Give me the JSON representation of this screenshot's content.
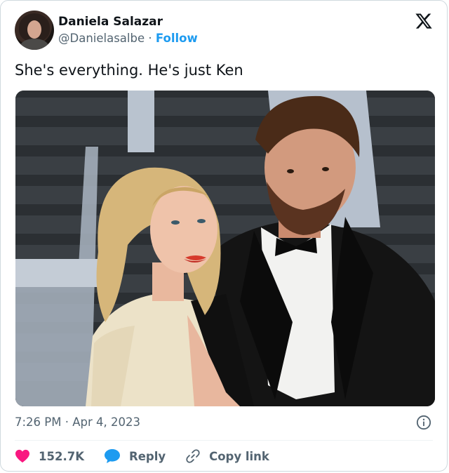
{
  "author": {
    "name": "Daniela Salazar",
    "handle": "@Danielasalbe",
    "separator": "·",
    "follow_label": "Follow"
  },
  "tweet": {
    "text": "She's everything. He's just Ken",
    "time": "7:26 PM",
    "date_separator": "·",
    "date": "Apr 4, 2023"
  },
  "actions": {
    "likes": "152.7K",
    "reply_label": "Reply",
    "copy_link_label": "Copy link"
  },
  "icons": {
    "logo": "x-logo-icon",
    "info": "info-icon",
    "like": "heart-icon",
    "reply": "reply-bubble-icon",
    "copy": "link-icon"
  },
  "colors": {
    "accent": "#1d9bf0",
    "like": "#f91880",
    "muted": "#536471",
    "text": "#0f1419"
  }
}
